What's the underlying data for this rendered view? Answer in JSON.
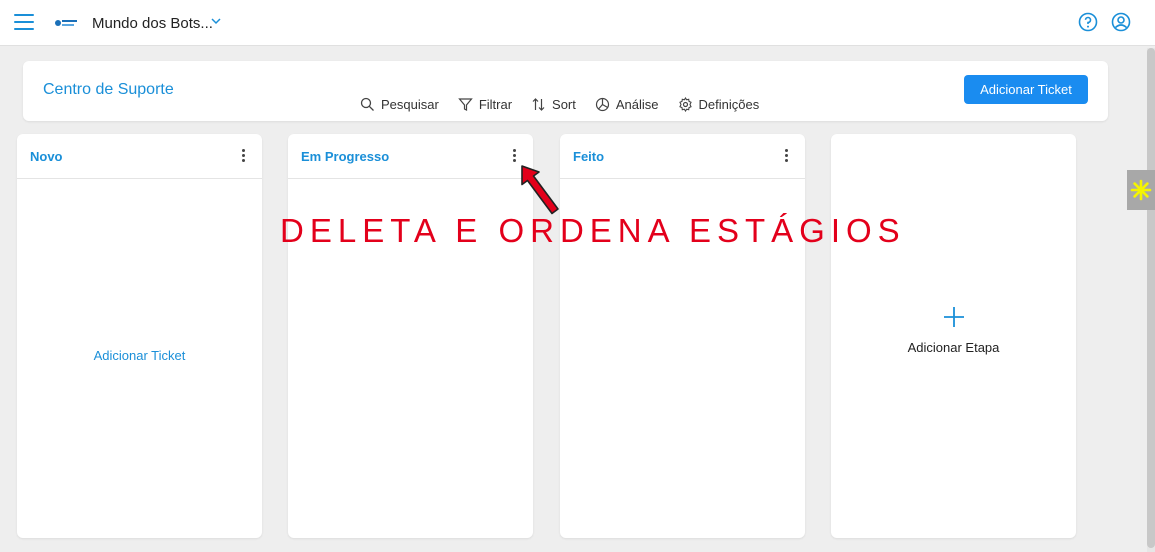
{
  "topbar": {
    "workspace_name": "Mundo dos Bots...",
    "icons": {
      "menu": "hamburger-icon",
      "logo": "workspace-logo",
      "chevron": "chevron-down-icon",
      "help": "help-circle-icon",
      "user": "user-avatar-icon"
    }
  },
  "header": {
    "title": "Centro de Suporte",
    "toolbar": [
      {
        "label": "Pesquisar",
        "icon": "search-icon"
      },
      {
        "label": "Filtrar",
        "icon": "filter-icon"
      },
      {
        "label": "Sort",
        "icon": "sort-icon"
      },
      {
        "label": "Análise",
        "icon": "chart-icon"
      },
      {
        "label": "Definições",
        "icon": "gear-icon"
      }
    ],
    "add_ticket_label": "Adicionar Ticket"
  },
  "columns": [
    {
      "title": "Novo",
      "add_label": "Adicionar Ticket"
    },
    {
      "title": "Em Progresso"
    },
    {
      "title": "Feito"
    }
  ],
  "add_stage": {
    "label": "Adicionar Etapa"
  },
  "annotation": {
    "text": "DELETA E ORDENA ESTÁGIOS"
  },
  "colors": {
    "accent": "#1a8fd8",
    "button": "#1a8cf0",
    "annotation": "#e3001b",
    "background": "#eeeeee"
  }
}
